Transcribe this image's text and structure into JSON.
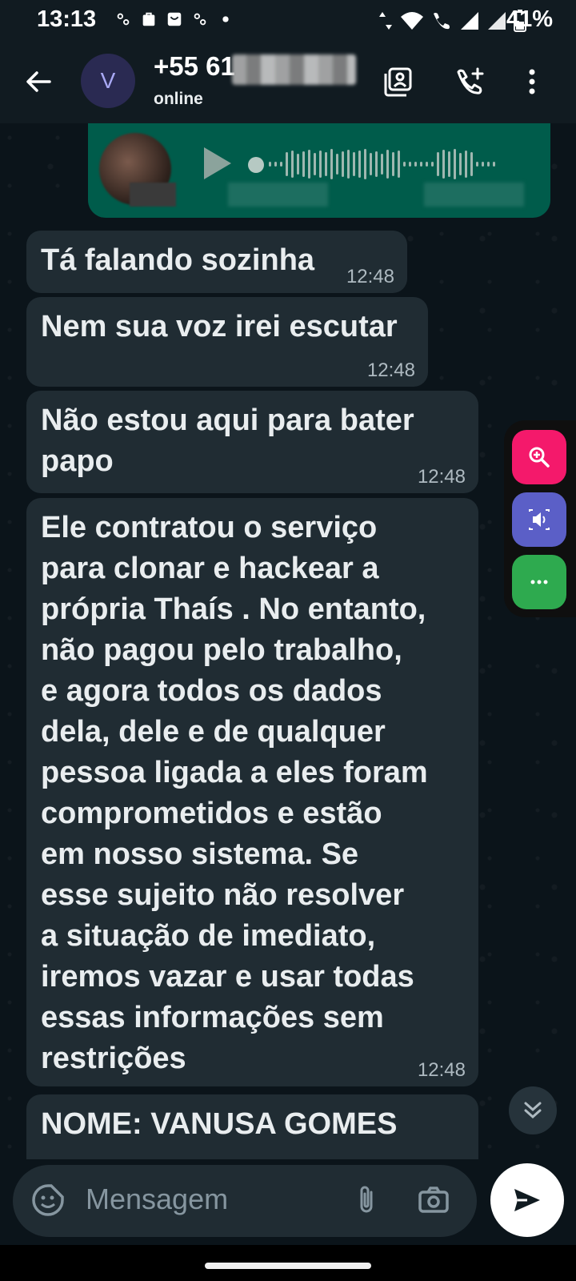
{
  "status_bar": {
    "time": "13:13",
    "battery": "41%"
  },
  "header": {
    "avatar_letter": "V",
    "contact_name": "+55 61",
    "contact_status": "online",
    "icons": [
      "back-arrow-icon",
      "contact-card-icon",
      "add-call-icon",
      "more-vert-icon"
    ]
  },
  "messages": [
    {
      "text": "Tá falando sozinha",
      "time": "12:48"
    },
    {
      "text": "Nem sua voz irei escutar",
      "time": "12:48"
    },
    {
      "text": "Não estou aqui para bater\npapo",
      "time": "12:48"
    },
    {
      "text": "Ele contratou o serviço\npara clonar e hackear a\nprópria Thaís . No entanto,\nnão pagou pelo trabalho,\ne agora todos os dados\ndela, dele e de qualquer\npessoa ligada a eles foram\ncomprometidos e estão\nem nosso sistema. Se\nesse sujeito não resolver\na situação de imediato,\niremos vazar e usar todas\nessas informações sem\nrestrições",
      "time": "12:48"
    },
    {
      "text": "NOME: VANUSA GOMES",
      "time": ""
    }
  ],
  "floating_tools": [
    "zoom-in-icon",
    "volume-icon",
    "more-horiz-icon"
  ],
  "floating_colors": {
    "zoom": "#f4196b",
    "volume": "#5b5fc7",
    "more": "#2eaa4f"
  },
  "composer": {
    "placeholder": "Mensagem"
  },
  "colors": {
    "header_bg": "#111b21",
    "incoming_bubble": "#202c33",
    "outgoing_bubble": "#005c4b"
  }
}
